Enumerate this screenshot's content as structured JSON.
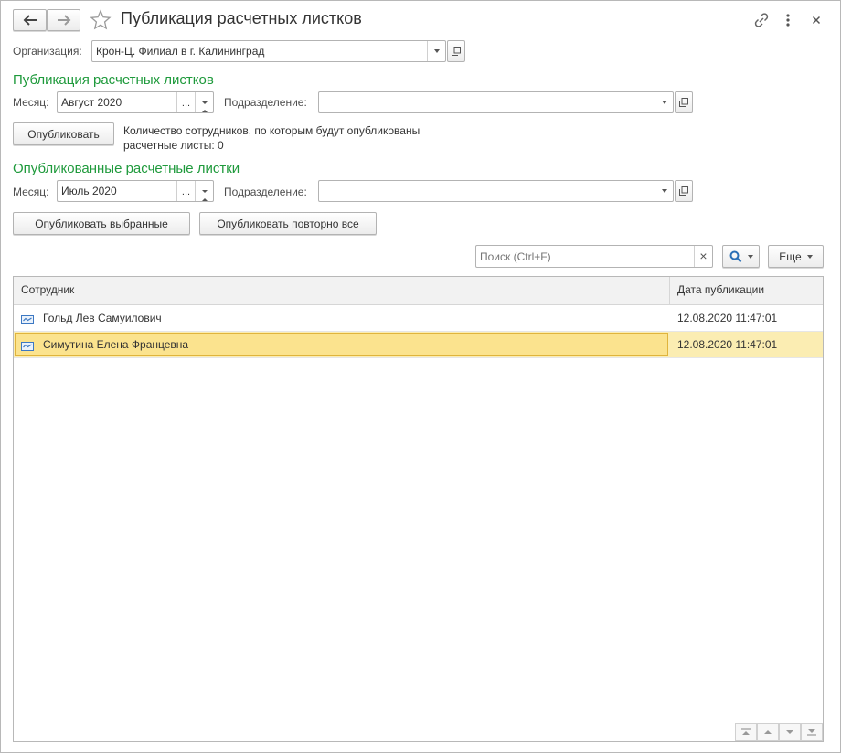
{
  "window": {
    "title": "Публикация расчетных листков"
  },
  "organization": {
    "label": "Организация:",
    "value": "Крон-Ц. Филиал в г. Калининград"
  },
  "publish_section": {
    "title": "Публикация расчетных листков",
    "month_label": "Месяц:",
    "month_value": "Август 2020",
    "choose_label": "...",
    "department_label": "Подразделение:",
    "department_value": "",
    "publish_button": "Опубликовать",
    "info_line1": "Количество сотрудников, по которым будут опубликованы",
    "info_line2": "расчетные листы: 0"
  },
  "published_section": {
    "title": "Опубликованные расчетные листки",
    "month_label": "Месяц:",
    "month_value": "Июль 2020",
    "choose_label": "...",
    "department_label": "Подразделение:",
    "department_value": "",
    "publish_selected_button": "Опубликовать выбранные",
    "republish_all_button": "Опубликовать повторно все"
  },
  "toolbar": {
    "search_placeholder": "Поиск (Ctrl+F)",
    "clear_label": "×",
    "more_button": "Еще"
  },
  "table": {
    "columns": [
      "Сотрудник",
      "Дата публикации"
    ],
    "rows": [
      {
        "employee": "Гольд Лев Самуилович",
        "date": "12.08.2020 11:47:01",
        "selected": false
      },
      {
        "employee": "Симутина Елена Францевна",
        "date": "12.08.2020 11:47:01",
        "selected": true
      }
    ]
  },
  "colors": {
    "accent_green": "#1f9a3c",
    "selected_row": "#fbedb2",
    "selected_cell": "#fbe38e",
    "selected_border": "#e0b43c"
  }
}
